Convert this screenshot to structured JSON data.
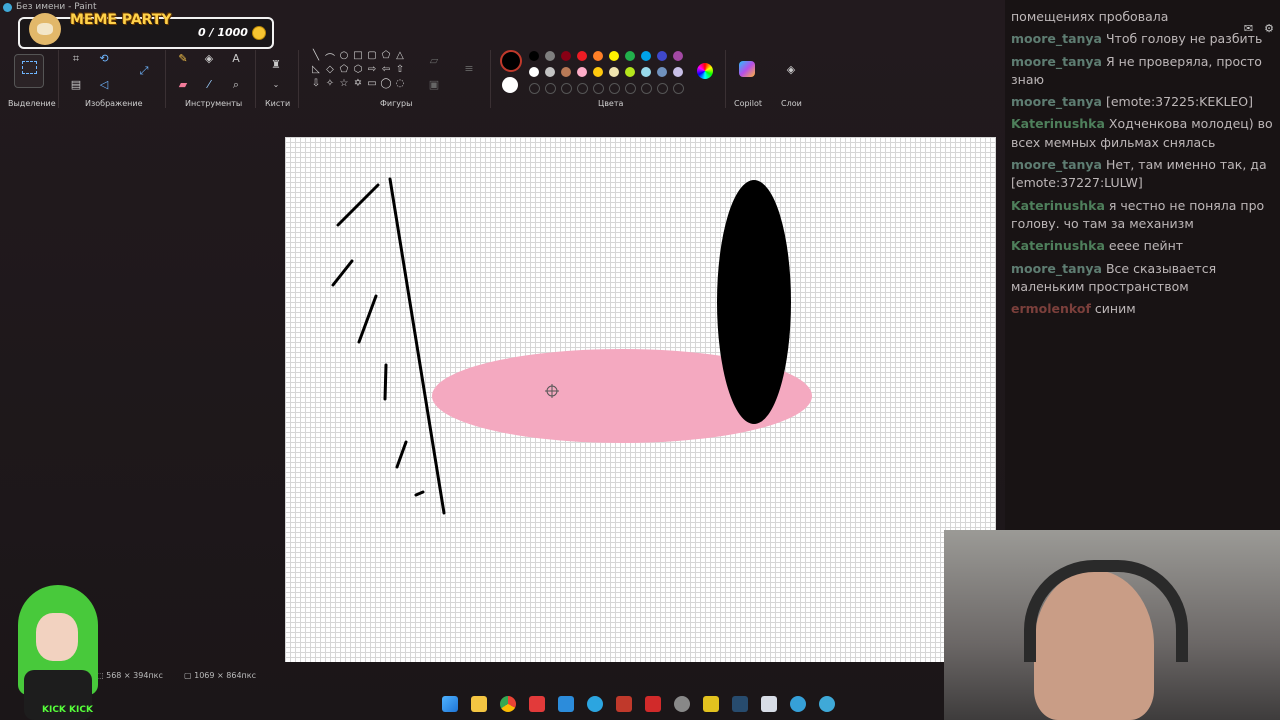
{
  "window": {
    "title": "Без имени - Paint"
  },
  "overlay": {
    "event": "MEME PARTY",
    "score": "0 / 1000"
  },
  "ribbon": {
    "groups": {
      "selection": "Выделение",
      "image": "Изображение",
      "tools": "Инструменты",
      "brushes": "Кисти",
      "shapes": "Фигуры",
      "colors": "Цвета",
      "copilot": "Copilot",
      "layers": "Слои"
    },
    "text_tool": "A"
  },
  "palette": [
    "#000000",
    "#7f7f7f",
    "#880015",
    "#ed1c24",
    "#ff7f27",
    "#fff200",
    "#22b14c",
    "#00a2e8",
    "#3f48cc",
    "#a349a4",
    "#ffffff",
    "#c3c3c3",
    "#b97a57",
    "#ffaec9",
    "#ffc90e",
    "#efe4b0",
    "#b5e61d",
    "#99d9ea",
    "#7092be",
    "#c8bfe7"
  ],
  "status": {
    "selection_size": "568 × 394пкс",
    "canvas_size": "1069 × 864пкс"
  },
  "chat": {
    "messages": [
      {
        "user": "",
        "text": "помещениях пробовала",
        "cls": ""
      },
      {
        "user": "moore_tanya",
        "text": "Чтоб голову не разбить",
        "cls": "u-moore"
      },
      {
        "user": "moore_tanya",
        "text": "Я не проверяла, просто знаю",
        "cls": "u-moore"
      },
      {
        "user": "moore_tanya",
        "text": "[emote:37225:KEKLEO]",
        "cls": "u-moore"
      },
      {
        "user": "Katerinushka",
        "text": "Ходченкова молодец) во всех мемных фильмах снялась",
        "cls": "u-kat"
      },
      {
        "user": "moore_tanya",
        "text": "Нет, там именно так, да [emote:37227:LULW]",
        "cls": "u-moore"
      },
      {
        "user": "Katerinushka",
        "text": "я честно не поняла про голову. чо там за механизм",
        "cls": "u-kat"
      },
      {
        "user": "Katerinushka",
        "text": "ееее пейнт",
        "cls": "u-kat"
      },
      {
        "user": "moore_tanya",
        "text": "Все сказывается маленьким пространством",
        "cls": "u-moore"
      },
      {
        "user": "ermolenkof",
        "text": "синим",
        "cls": "u-erm"
      }
    ]
  },
  "avatar_badge": "KICK KICK",
  "icons": [
    "select-icon",
    "crop-icon",
    "rotate-icon",
    "resize-icon",
    "pencil-icon",
    "fill-icon",
    "text-icon",
    "eraser-icon",
    "picker-icon",
    "zoom-icon",
    "brush-icon",
    "palette-icon",
    "copilot-icon",
    "layers-icon",
    "chat-icon",
    "settings-icon"
  ],
  "colors": {
    "pink_ellipse": "#f4a9c0",
    "black_ellipse": "#000000",
    "accent": "#6fb6ff"
  }
}
